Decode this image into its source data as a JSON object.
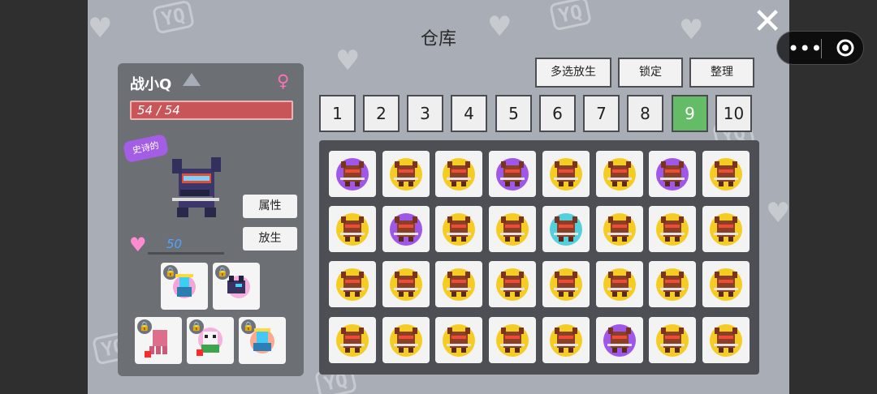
{
  "screen": {
    "title": "仓库",
    "close_icon": "close-icon",
    "background_color": "#a9aeb6"
  },
  "left_panel": {
    "pet_name": "战小Q",
    "rank_icon": "rank-icon",
    "gender_icon": "female-icon",
    "hp_text": "54 / 54",
    "quality_badge": "史诗的",
    "pet_icon": "warrior-pet-icon",
    "heart_icon": "heart-icon",
    "love_value": "50",
    "buttons": {
      "attributes": "属性",
      "release": "放生"
    },
    "companions": [
      {
        "pet_icon": "spirit-pet-icon",
        "lock_icon": "lock-icon"
      },
      {
        "pet_icon": "dark-pet-icon",
        "lock_icon": "lock-icon"
      },
      {
        "pet_icon": "octopus-pet-icon",
        "lock_icon": "lock-icon"
      },
      {
        "pet_icon": "panda-pet-icon",
        "lock_icon": "lock-icon"
      },
      {
        "pet_icon": "flower-pet-icon",
        "lock_icon": "lock-icon"
      }
    ]
  },
  "toolbar": {
    "multi_release": "多选放生",
    "lock": "锁定",
    "organize": "整理"
  },
  "pages": [
    "1",
    "2",
    "3",
    "4",
    "5",
    "6",
    "7",
    "8",
    "9",
    "10"
  ],
  "active_page": "9",
  "inventory": {
    "rows": 4,
    "cols": 8,
    "items": [
      {
        "pet_icon": "warrior-pet-icon",
        "aura": "#9e57e9"
      },
      {
        "pet_icon": "warrior-pet-icon",
        "aura": "#f4cc22"
      },
      {
        "pet_icon": "warrior-pet-icon",
        "aura": "#f4cc22"
      },
      {
        "pet_icon": "warrior-pet-icon",
        "aura": "#9e57e9"
      },
      {
        "pet_icon": "warrior-pet-icon",
        "aura": "#f4cc22"
      },
      {
        "pet_icon": "warrior-pet-icon",
        "aura": "#f4cc22"
      },
      {
        "pet_icon": "warrior-pet-icon",
        "aura": "#9e57e9"
      },
      {
        "pet_icon": "warrior-pet-icon",
        "aura": "#f4cc22"
      },
      {
        "pet_icon": "warrior-pet-icon",
        "aura": "#f4cc22"
      },
      {
        "pet_icon": "warrior-pet-icon",
        "aura": "#9e57e9"
      },
      {
        "pet_icon": "warrior-pet-icon",
        "aura": "#f4cc22"
      },
      {
        "pet_icon": "warrior-pet-icon",
        "aura": "#f4cc22"
      },
      {
        "pet_icon": "warrior-pet-icon",
        "aura": "#53d0dc"
      },
      {
        "pet_icon": "warrior-pet-icon",
        "aura": "#f4cc22"
      },
      {
        "pet_icon": "warrior-pet-icon",
        "aura": "#f4cc22"
      },
      {
        "pet_icon": "warrior-pet-icon",
        "aura": "#f4cc22"
      },
      {
        "pet_icon": "warrior-pet-icon",
        "aura": "#f4cc22"
      },
      {
        "pet_icon": "warrior-pet-icon",
        "aura": "#f4cc22"
      },
      {
        "pet_icon": "warrior-pet-icon",
        "aura": "#f4cc22"
      },
      {
        "pet_icon": "warrior-pet-icon",
        "aura": "#f4cc22"
      },
      {
        "pet_icon": "warrior-pet-icon",
        "aura": "#f4cc22"
      },
      {
        "pet_icon": "warrior-pet-icon",
        "aura": "#f4cc22"
      },
      {
        "pet_icon": "warrior-pet-icon",
        "aura": "#f4cc22"
      },
      {
        "pet_icon": "warrior-pet-icon",
        "aura": "#f4cc22"
      },
      {
        "pet_icon": "warrior-pet-icon",
        "aura": "#f4cc22"
      },
      {
        "pet_icon": "warrior-pet-icon",
        "aura": "#f4cc22"
      },
      {
        "pet_icon": "warrior-pet-icon",
        "aura": "#f4cc22"
      },
      {
        "pet_icon": "warrior-pet-icon",
        "aura": "#f4cc22"
      },
      {
        "pet_icon": "warrior-pet-icon",
        "aura": "#f4cc22"
      },
      {
        "pet_icon": "warrior-pet-icon",
        "aura": "#9e57e9"
      },
      {
        "pet_icon": "warrior-pet-icon",
        "aura": "#f4cc22"
      },
      {
        "pet_icon": "warrior-pet-icon",
        "aura": "#f4cc22"
      }
    ]
  },
  "wechat_capsule": {
    "more_icon": "more-icon",
    "target_icon": "target-icon"
  }
}
